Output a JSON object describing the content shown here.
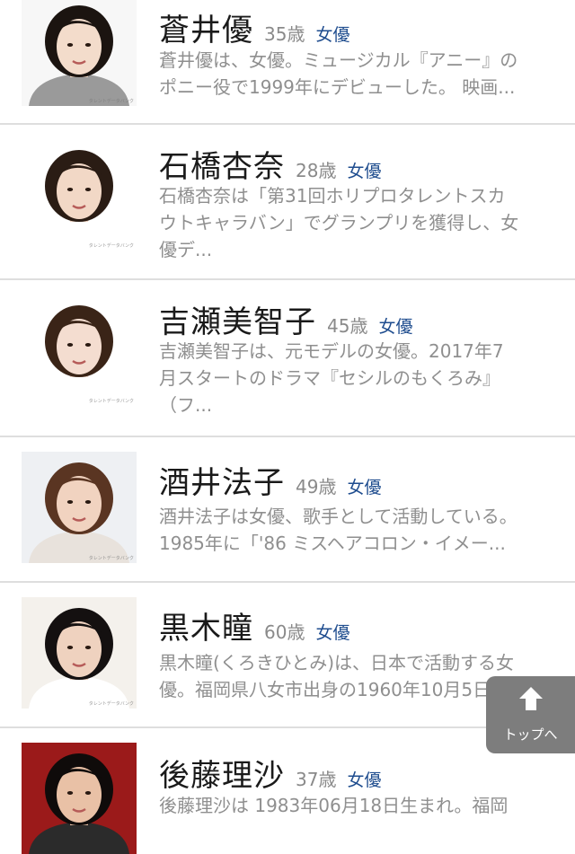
{
  "actresses": [
    {
      "name": "蒼井優",
      "age": "35歳",
      "occupation": "女優",
      "desc": [
        "蒼井優は、女優。ミュージカル『アニー』の",
        "ポニー役で1999年にデビューした。 映画..."
      ],
      "watermark": "タレントデータバンク"
    },
    {
      "name": "石橋杏奈",
      "age": "28歳",
      "occupation": "女優",
      "desc": [
        "石橋杏奈は「第31回ホリプロタレントスカ",
        "ウトキャラバン」でグランプリを獲得し、女",
        "優デ..."
      ],
      "watermark": "タレントデータバンク"
    },
    {
      "name": "吉瀬美智子",
      "age": "45歳",
      "occupation": "女優",
      "desc": [
        "吉瀬美智子は、元モデルの女優。2017年7",
        "月スタートのドラマ『セシルのもくろみ』",
        "（フ..."
      ],
      "watermark": "タレントデータバンク"
    },
    {
      "name": "酒井法子",
      "age": "49歳",
      "occupation": "女優",
      "desc": [
        "酒井法子は女優、歌手として活動している。",
        "1985年に「'86 ミスヘアコロン・イメー..."
      ],
      "watermark": "タレントデータバンク"
    },
    {
      "name": "黒木瞳",
      "age": "60歳",
      "occupation": "女優",
      "desc": [
        "黒木瞳(くろきひとみ)は、日本で活動する女",
        "優。福岡県八女市出身の1960年10月5日..."
      ],
      "watermark": "タレントデータバンク"
    },
    {
      "name": "後藤理沙",
      "age": "37歳",
      "occupation": "女優",
      "desc": [
        "後藤理沙は 1983年06月18日生まれ。福岡"
      ],
      "watermark": ""
    }
  ],
  "back_to_top": {
    "label": "トップへ",
    "icon": "arrow-up-icon"
  },
  "colors": {
    "occupation": "#1f4d8f",
    "age": "#8a8a8a",
    "desc": "#8f8f8f",
    "top_button": "#7d7d7d"
  }
}
